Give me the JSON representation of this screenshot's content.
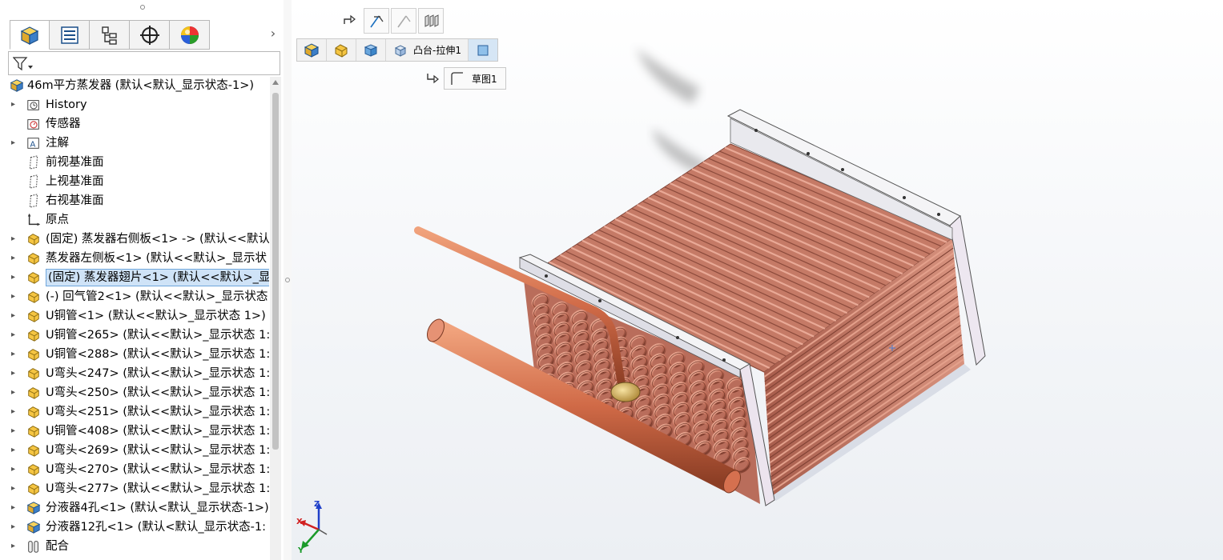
{
  "tree": {
    "root_label": "46m平方蒸发器 (默认<默认_显示状态-1>)",
    "items": [
      {
        "label": "History",
        "icon": "history-icon",
        "expandable": true
      },
      {
        "label": "传感器",
        "icon": "sensor-icon",
        "expandable": false
      },
      {
        "label": "注解",
        "icon": "annotation-icon",
        "expandable": true
      },
      {
        "label": "前视基准面",
        "icon": "plane-icon",
        "expandable": false
      },
      {
        "label": "上视基准面",
        "icon": "plane-icon",
        "expandable": false
      },
      {
        "label": "右视基准面",
        "icon": "plane-icon",
        "expandable": false
      },
      {
        "label": "原点",
        "icon": "origin-icon",
        "expandable": false
      },
      {
        "label": "(固定) 蒸发器右侧板<1> -> (默认<<默认",
        "icon": "part-icon",
        "expandable": true
      },
      {
        "label": "蒸发器左侧板<1> (默认<<默认>_显示状",
        "icon": "part-icon",
        "expandable": true
      },
      {
        "label": "(固定) 蒸发器翅片<1> (默认<<默认>_显",
        "icon": "part-icon",
        "expandable": true,
        "selected": true
      },
      {
        "label": "(-) 回气管2<1> (默认<<默认>_显示状态",
        "icon": "part-icon",
        "expandable": true
      },
      {
        "label": "U铜管<1> (默认<<默认>_显示状态 1>)",
        "icon": "part-icon",
        "expandable": true
      },
      {
        "label": "U铜管<265> (默认<<默认>_显示状态 1:",
        "icon": "part-icon",
        "expandable": true
      },
      {
        "label": "U铜管<288> (默认<<默认>_显示状态 1:",
        "icon": "part-icon",
        "expandable": true
      },
      {
        "label": "U弯头<247> (默认<<默认>_显示状态 1:",
        "icon": "part-icon",
        "expandable": true
      },
      {
        "label": "U弯头<250> (默认<<默认>_显示状态 1:",
        "icon": "part-icon",
        "expandable": true
      },
      {
        "label": "U弯头<251> (默认<<默认>_显示状态 1:",
        "icon": "part-icon",
        "expandable": true
      },
      {
        "label": "U铜管<408> (默认<<默认>_显示状态 1:",
        "icon": "part-icon",
        "expandable": true
      },
      {
        "label": "U弯头<269> (默认<<默认>_显示状态 1:",
        "icon": "part-icon",
        "expandable": true
      },
      {
        "label": "U弯头<270> (默认<<默认>_显示状态 1:",
        "icon": "part-icon",
        "expandable": true
      },
      {
        "label": "U弯头<277> (默认<<默认>_显示状态 1:",
        "icon": "part-icon",
        "expandable": true
      },
      {
        "label": "分液器4孔<1> (默认<默认_显示状态-1>)",
        "icon": "assembly-icon",
        "expandable": true
      },
      {
        "label": "分液器12孔<1> (默认<默认_显示状态-1:",
        "icon": "assembly-icon",
        "expandable": true
      },
      {
        "label": "配合",
        "icon": "mates-icon",
        "expandable": true
      }
    ]
  },
  "tabs": [
    {
      "name": "feature-manager-tab",
      "icon": "feature-manager-icon"
    },
    {
      "name": "property-manager-tab",
      "icon": "property-manager-icon"
    },
    {
      "name": "configuration-manager-tab",
      "icon": "configuration-manager-icon"
    },
    {
      "name": "dimxpert-tab",
      "icon": "crosshair-icon"
    },
    {
      "name": "display-manager-tab",
      "icon": "appearance-icon"
    }
  ],
  "breadcrumb": {
    "items": [
      "assembly",
      "subassembly",
      "part",
      "feature"
    ],
    "feature_label": "凸台-拉伸1",
    "sketch_label": "草图1"
  },
  "triad": {
    "x": "X",
    "y": "Y",
    "z": "Z"
  },
  "colors": {
    "copper": "#c97f6a",
    "copper_dark": "#8f4d3d",
    "frame": "#f2f2f4",
    "selection": "#cfe3f7",
    "part_yellow": "#f5c542"
  }
}
